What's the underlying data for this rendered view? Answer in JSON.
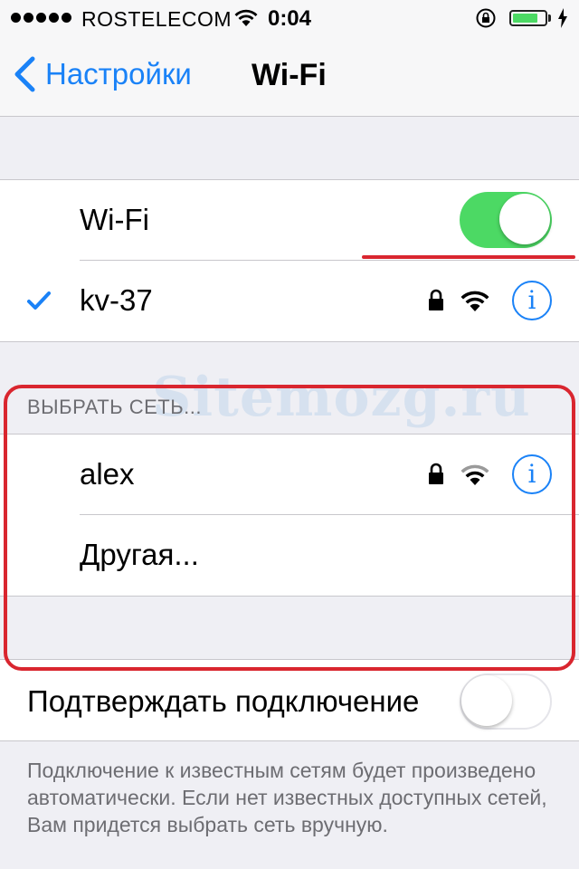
{
  "status_bar": {
    "carrier": "ROSTELECOM",
    "time": "0:04",
    "battery_level": 0.8,
    "signal_bars": 5
  },
  "nav": {
    "back_label": "Настройки",
    "title": "Wi-Fi"
  },
  "wifi": {
    "label": "Wi-Fi",
    "enabled": true
  },
  "connected_network": {
    "name": "kv-37",
    "secured": true
  },
  "choose_network": {
    "header": "ВЫБРАТЬ СЕТЬ...",
    "networks": [
      {
        "name": "alex",
        "secured": true
      }
    ],
    "other_label": "Другая..."
  },
  "ask_to_join": {
    "label": "Подтверждать подключение",
    "enabled": false,
    "description": "Подключение к известным сетям будет произведено автоматически. Если нет известных доступных сетей, Вам придется выбрать сеть вручную."
  },
  "watermark": "Sitemozg.ru",
  "colors": {
    "accent": "#1a82f7",
    "toggle_on": "#4cd964",
    "highlight": "#d9262f",
    "background": "#efeff4"
  }
}
